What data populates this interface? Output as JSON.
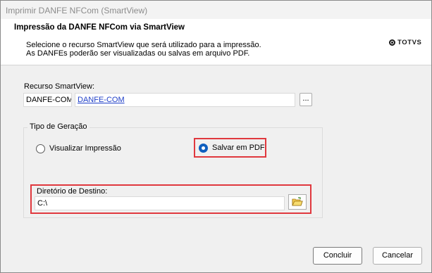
{
  "window": {
    "title": "Imprimir DANFE NFCom (SmartView)"
  },
  "header": {
    "title": "Impressão da DANFE NFCom via SmartView",
    "desc_line1": "Selecione o recurso SmartView que será utilizado para a impressão.",
    "desc_line2": "As DANFEs poderão ser visualizadas ou salvas em arquivo PDF.",
    "logo_text": "TOTVS"
  },
  "recurso": {
    "label": "Recurso SmartView:",
    "code": "DANFE-COM",
    "description": "DANFE-COM",
    "browse_label": "..."
  },
  "geracao": {
    "legend": "Tipo de Geração",
    "options": [
      {
        "label": "Visualizar Impressão",
        "selected": false
      },
      {
        "label": "Salvar em PDF",
        "selected": true
      }
    ]
  },
  "destino": {
    "label": "Diretório de Destino:",
    "value": "C:\\"
  },
  "footer": {
    "concluir_label": "Concluir",
    "cancelar_label": "Cancelar"
  },
  "colors": {
    "highlight": "#e0383e",
    "link": "#2040c8",
    "accent": "#0f5fbf"
  }
}
